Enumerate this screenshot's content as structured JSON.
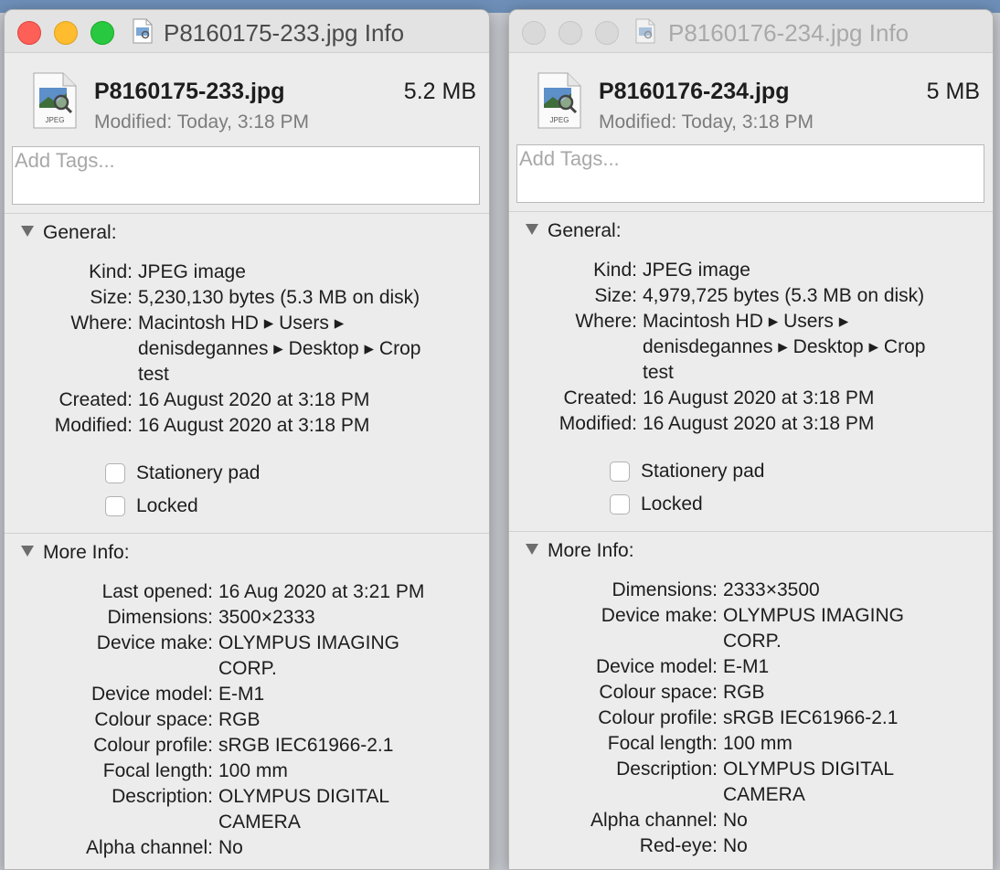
{
  "win1": {
    "title": "P8160175-233.jpg Info",
    "filename": "P8160175-233.jpg",
    "size_short": "5.2 MB",
    "modified": "Modified:  Today, 3:18 PM",
    "tags_placeholder": "Add Tags...",
    "icon_label": "JPEG",
    "general_title": "General:",
    "general": [
      {
        "label": "Kind:",
        "value": "JPEG image"
      },
      {
        "label": "Size:",
        "value": "5,230,130 bytes (5.3 MB on disk)"
      },
      {
        "label": "Where:",
        "value": "Macintosh HD ▸ Users ▸"
      },
      {
        "label": "",
        "value": "denisdegannes ▸ Desktop ▸ Crop"
      },
      {
        "label": "",
        "value": "test"
      },
      {
        "label": "Created:",
        "value": "16 August 2020 at 3:18 PM"
      },
      {
        "label": "Modified:",
        "value": "16 August 2020 at 3:18 PM"
      }
    ],
    "stationery": "Stationery pad",
    "locked": "Locked",
    "more_title": "More Info:",
    "more": [
      {
        "label": "Last opened:",
        "value": "16 Aug 2020 at 3:21 PM"
      },
      {
        "label": "Dimensions:",
        "value": "3500×2333"
      },
      {
        "label": "Device make:",
        "value": "OLYMPUS IMAGING"
      },
      {
        "label": "",
        "value": "CORP."
      },
      {
        "label": "Device model:",
        "value": "E-M1"
      },
      {
        "label": "Colour space:",
        "value": "RGB"
      },
      {
        "label": "Colour profile:",
        "value": "sRGB IEC61966-2.1"
      },
      {
        "label": "Focal length:",
        "value": "100 mm"
      },
      {
        "label": "Description:",
        "value": "OLYMPUS DIGITAL"
      },
      {
        "label": "",
        "value": "CAMERA"
      },
      {
        "label": "Alpha channel:",
        "value": "No"
      }
    ]
  },
  "win2": {
    "title": "P8160176-234.jpg Info",
    "filename": "P8160176-234.jpg",
    "size_short": "5 MB",
    "modified": "Modified:  Today, 3:18 PM",
    "tags_placeholder": "Add Tags...",
    "icon_label": "JPEG",
    "general_title": "General:",
    "general": [
      {
        "label": "Kind:",
        "value": "JPEG image"
      },
      {
        "label": "Size:",
        "value": "4,979,725 bytes (5.3 MB on disk)"
      },
      {
        "label": "Where:",
        "value": "Macintosh HD ▸ Users ▸"
      },
      {
        "label": "",
        "value": "denisdegannes ▸ Desktop ▸ Crop"
      },
      {
        "label": "",
        "value": "test"
      },
      {
        "label": "Created:",
        "value": "16 August 2020 at 3:18 PM"
      },
      {
        "label": "Modified:",
        "value": "16 August 2020 at 3:18 PM"
      }
    ],
    "stationery": "Stationery pad",
    "locked": "Locked",
    "more_title": "More Info:",
    "more": [
      {
        "label": "Dimensions:",
        "value": "2333×3500"
      },
      {
        "label": "Device make:",
        "value": "OLYMPUS IMAGING"
      },
      {
        "label": "",
        "value": "CORP."
      },
      {
        "label": "Device model:",
        "value": "E-M1"
      },
      {
        "label": "Colour space:",
        "value": "RGB"
      },
      {
        "label": "Colour profile:",
        "value": "sRGB IEC61966-2.1"
      },
      {
        "label": "Focal length:",
        "value": "100 mm"
      },
      {
        "label": "Description:",
        "value": "OLYMPUS DIGITAL"
      },
      {
        "label": "",
        "value": "CAMERA"
      },
      {
        "label": "Alpha channel:",
        "value": "No"
      },
      {
        "label": "Red-eye:",
        "value": "No"
      }
    ]
  }
}
